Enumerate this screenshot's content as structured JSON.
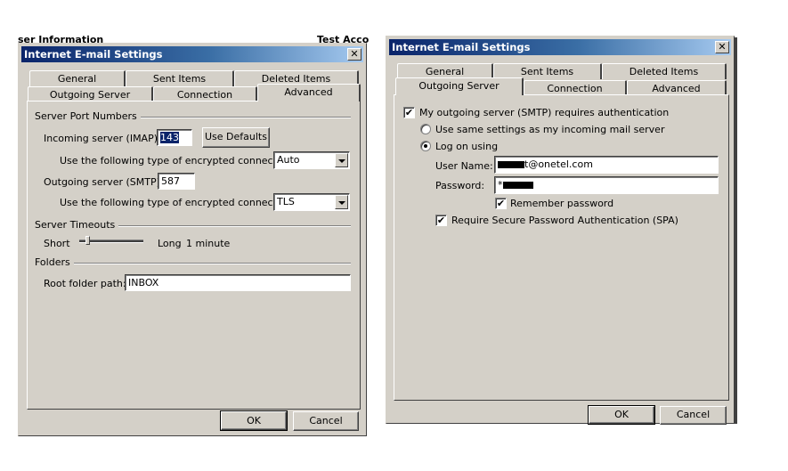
{
  "background": {
    "left_text_top": "ser Information",
    "right_text_top": "Test Acco"
  },
  "dialog_left": {
    "title": "Internet E-mail Settings",
    "close_icon": "close-icon",
    "tabs_row1": [
      {
        "label": "General"
      },
      {
        "label": "Sent Items"
      },
      {
        "label": "Deleted Items"
      }
    ],
    "tabs_row2": [
      {
        "label": "Outgoing Server"
      },
      {
        "label": "Connection"
      },
      {
        "label": "Advanced",
        "active": true
      }
    ],
    "server_ports": {
      "group_label": "Server Port Numbers",
      "incoming_label": "Incoming server (IMAP):",
      "incoming_value": "143",
      "use_defaults_label": "Use Defaults",
      "incoming_enc_label": "Use the following type of encrypted connection:",
      "incoming_enc_value": "Auto",
      "outgoing_label": "Outgoing server (SMTP):",
      "outgoing_value": "587",
      "outgoing_enc_label": "Use the following type of encrypted connection:",
      "outgoing_enc_value": "TLS"
    },
    "timeouts": {
      "group_label": "Server Timeouts",
      "short_label": "Short",
      "long_label": "Long",
      "value_text": "1 minute",
      "slider_fraction": 0.1
    },
    "folders": {
      "group_label": "Folders",
      "root_label": "Root folder path:",
      "root_value": "INBOX"
    },
    "ok_label": "OK",
    "cancel_label": "Cancel"
  },
  "dialog_right": {
    "title": "Internet E-mail Settings",
    "close_icon": "close-icon",
    "tabs_row1": [
      {
        "label": "General"
      },
      {
        "label": "Sent Items"
      },
      {
        "label": "Deleted Items"
      }
    ],
    "tabs_row2": [
      {
        "label": "Outgoing Server",
        "active": true
      },
      {
        "label": "Connection"
      },
      {
        "label": "Advanced"
      }
    ],
    "smtp_auth_label": "My outgoing server (SMTP) requires authentication",
    "smtp_auth_checked": true,
    "same_settings_label": "Use same settings as my incoming mail server",
    "same_settings_selected": false,
    "log_on_label": "Log on using",
    "log_on_selected": true,
    "username_label": "User Name:",
    "username_value_visible": "t@onetel.com",
    "password_label": "Password:",
    "password_value_visible": "*",
    "remember_label": "Remember password",
    "remember_checked": true,
    "spa_label": "Require Secure Password Authentication (SPA)",
    "spa_checked": true,
    "ok_label": "OK",
    "cancel_label": "Cancel"
  }
}
